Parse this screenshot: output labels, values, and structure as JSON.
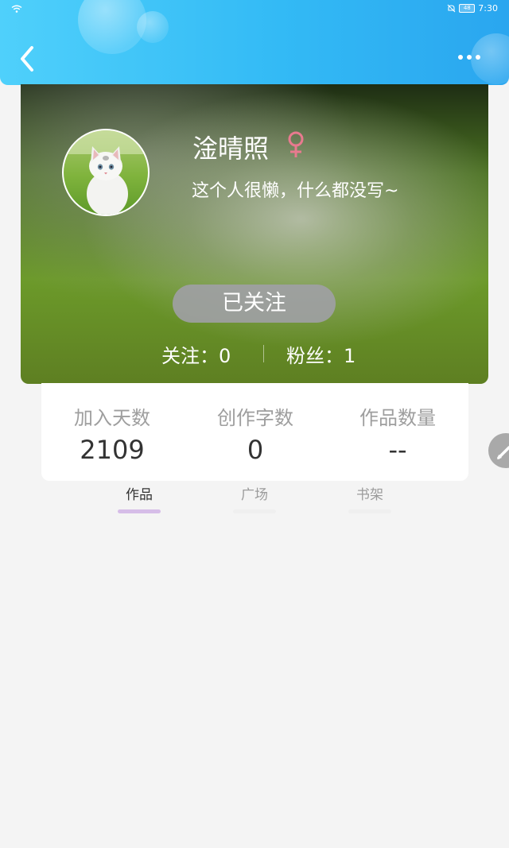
{
  "status_bar": {
    "time": "7:30",
    "battery": "48"
  },
  "profile": {
    "name": "淦晴照",
    "gender_symbol": "♀",
    "bio": "这个人很懒，什么都没写~",
    "follow_button_label": "已关注",
    "following_label": "关注：0",
    "fans_label": "粉丝：1"
  },
  "summary": {
    "join_days_label": "加入天数",
    "join_days_value": "2109",
    "word_count_label": "创作字数",
    "word_count_value": "0",
    "works_count_label": "作品数量",
    "works_count_value": "--"
  },
  "tabs": {
    "works": "作品",
    "square": "广场",
    "shelf": "书架",
    "active": "works"
  },
  "colors": {
    "header_accent": "#33baf5",
    "gender_icon": "#e87a8f",
    "active_tab_underline": "#d6bde8"
  },
  "icons": [
    "wifi-icon",
    "mute-icon",
    "back-icon",
    "more-icon",
    "female-icon",
    "pencil-icon"
  ]
}
